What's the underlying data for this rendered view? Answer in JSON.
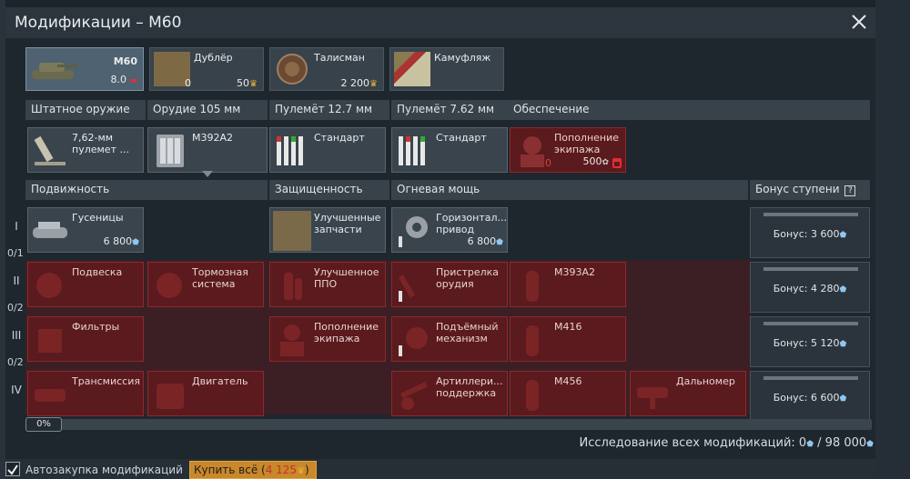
{
  "window": {
    "title": "Модификации – M60"
  },
  "tabs": {
    "vehicle": {
      "name": "M60",
      "rank": "8.0"
    },
    "backup": {
      "name": "Дублёр",
      "count": "0",
      "price": "50"
    },
    "talisman": {
      "name": "Талисман",
      "price": "2 200"
    },
    "camo": {
      "name": "Камуфляж"
    }
  },
  "weapons": {
    "headers": [
      "Штатное оружие",
      "Орудие 105 мм",
      "Пулемёт 12.7 мм",
      "Пулемёт 7.62 мм",
      "Обеспечение"
    ],
    "items": [
      {
        "label": "7,62-мм пулемет ...",
        "icon": "mortar-icon"
      },
      {
        "label": "M392A2",
        "icon": "shells-icon"
      },
      {
        "label": "Стандарт",
        "icon": "bullets-icon"
      },
      {
        "label": "Стандарт",
        "icon": "bullets-icon"
      },
      {
        "label": "Пополнение экипажа",
        "count": "0",
        "price": "500",
        "icon": "crew-icon"
      }
    ]
  },
  "sections": {
    "mobility": "Подвижность",
    "protection": "Защищенность",
    "firepower": "Огневая мощь",
    "bonus_header": "Бонус ступени",
    "bonus_help": "?"
  },
  "tiers": {
    "labels": [
      "I",
      "II",
      "III",
      "IV"
    ],
    "fractions": [
      "0/1",
      "0/2",
      "0/2"
    ]
  },
  "mods": {
    "tier1": {
      "tracks": {
        "label": "Гусеницы",
        "price": "6 800"
      },
      "parts": {
        "label": "Улучшенные запчасти"
      },
      "horiz": {
        "label": "Горизонтал... привод",
        "price": "6 800"
      }
    },
    "tier2": {
      "suspension": "Подвеска",
      "brakes": "Тормозная система",
      "fire_ext": "Улучшенное ППО",
      "adjust": "Пристрелка орудия",
      "m393a2": "M393A2"
    },
    "tier3": {
      "filters": "Фильтры",
      "crew": "Пополнение экипажа",
      "elevation": "Подъёмный механизм",
      "m416": "M416"
    },
    "tier4": {
      "transmission": "Трансмиссия",
      "engine": "Двигатель",
      "artillery": "Артиллери... поддержка",
      "m456": "M456",
      "rangefinder": "Дальномер"
    }
  },
  "bonuses": [
    "Бонус: 3 600",
    "Бонус: 4 280",
    "Бонус: 5 120",
    "Бонус: 6 600"
  ],
  "progress": {
    "percent_label": "0%",
    "value": 0
  },
  "research": {
    "label": "Исследование всех модификаций: 0",
    "total": "98 000"
  },
  "footer": {
    "autobuy": "Автозакупка модификаций",
    "buy_all": "Купить всё",
    "buy_price": "4 125",
    "autobuy_checked": true
  },
  "colors": {
    "red_locked": "#5b1a1d",
    "gray_cell": "#3a444d",
    "buy_button": "#c9882a",
    "accent_blue": "#8fc6f0"
  }
}
